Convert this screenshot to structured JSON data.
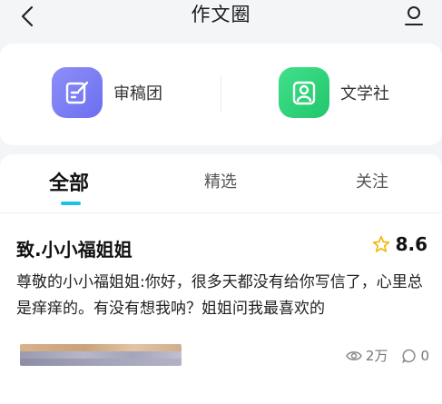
{
  "header": {
    "title": "作文圈",
    "back_icon": "chevron-left-icon",
    "profile_icon": "user-icon"
  },
  "shortcuts": [
    {
      "label": "审稿团",
      "icon": "edit-note-icon",
      "color": "#7b7cf5"
    },
    {
      "label": "文学社",
      "icon": "person-badge-icon",
      "color": "#2fd27a"
    }
  ],
  "tabs": [
    {
      "label": "全部",
      "active": true
    },
    {
      "label": "精选",
      "active": false
    },
    {
      "label": "关注",
      "active": false
    }
  ],
  "colors": {
    "accent": "#19c3e8",
    "star": "#f2b705",
    "background": "#f4f5f7"
  },
  "post": {
    "title": "致.小小福姐姐",
    "score": "8.6",
    "excerpt": "尊敬的小小福姐姐:你好，很多天都没有给你写信了，心里总是痒痒的。有没有想我呐？姐姐问我最喜欢的",
    "views": "2万",
    "comments": "0"
  }
}
